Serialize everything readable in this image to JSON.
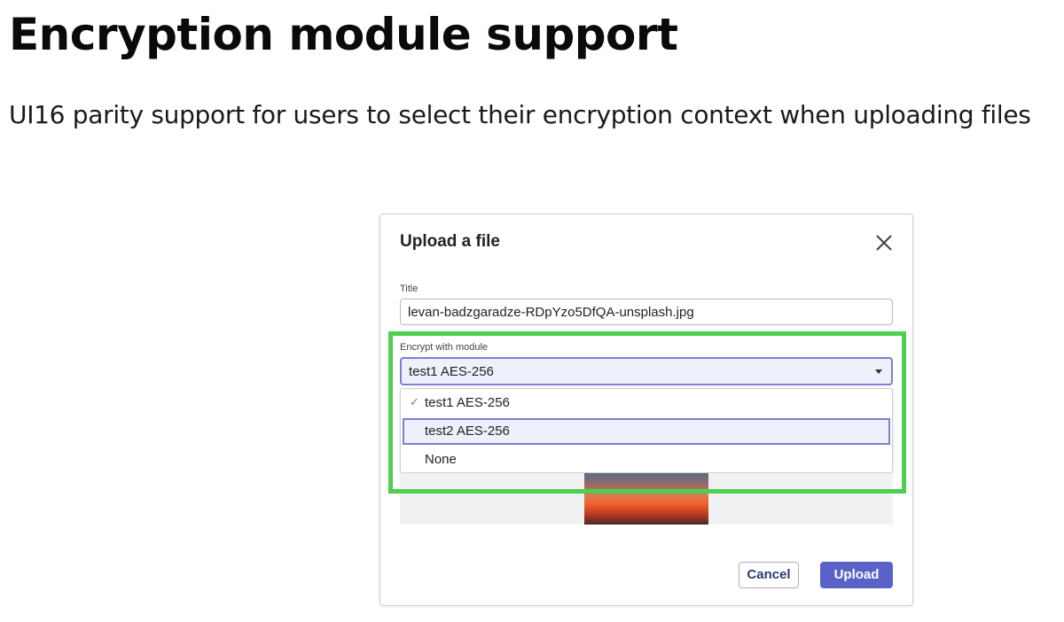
{
  "slide": {
    "heading": "Encryption module support",
    "subheading": "UI16 parity support for users to select their encryption context when uploading files"
  },
  "dialog": {
    "title": "Upload a file",
    "close_icon": "close-icon",
    "title_field": {
      "label": "Title",
      "value": "levan-badzgaradze-RDpYzo5DfQA-unsplash.jpg"
    },
    "encrypt_field": {
      "label": "Encrypt with module",
      "selected": "test1 AES-256",
      "options": [
        "test1 AES-256",
        "test2 AES-256",
        "None"
      ],
      "checked_index": 0,
      "hovered_index": 1
    },
    "buttons": {
      "cancel": "Cancel",
      "upload": "Upload"
    }
  },
  "colors": {
    "highlight": "#4fcf4f",
    "accent": "#5b62c7",
    "selection_bg": "#eef0fb"
  }
}
